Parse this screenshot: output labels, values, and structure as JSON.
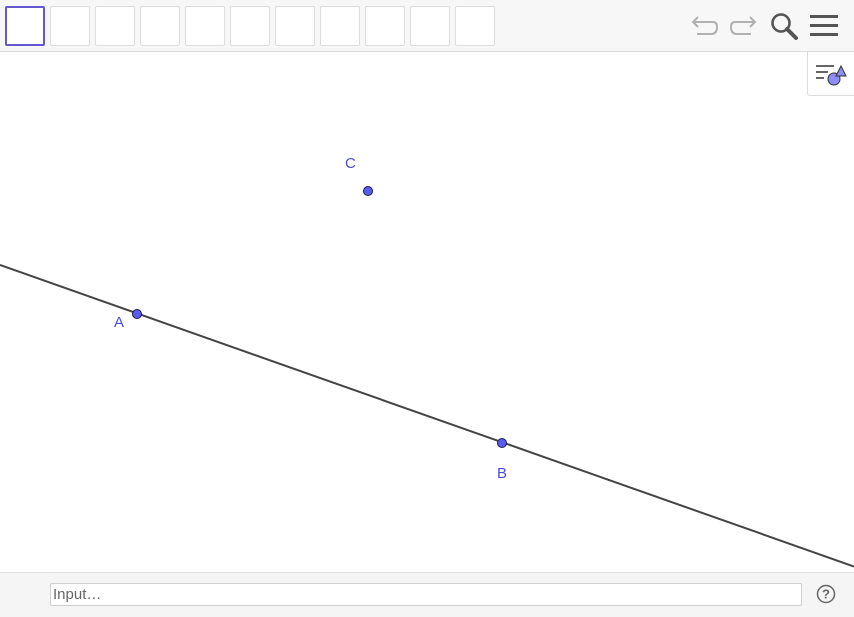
{
  "toolbar": {
    "tool_count": 11,
    "active_tool_index": 0,
    "undo_icon": "undo-icon",
    "redo_icon": "redo-icon",
    "search_icon": "search-icon",
    "menu_icon": "hamburger-menu-icon"
  },
  "stylebar": {
    "icon": "style-bar-toggle-icon"
  },
  "graphics": {
    "points": [
      {
        "name": "A",
        "label": "A"
      },
      {
        "name": "B",
        "label": "B"
      },
      {
        "name": "C",
        "label": "C"
      }
    ],
    "line": {
      "through": [
        "A",
        "B"
      ]
    },
    "colors": {
      "point_fill": "#5b5bef",
      "point_stroke": "#1a1a4d",
      "label": "#4b4bd6",
      "line": "#444444",
      "active_tool_border": "#6557d2"
    }
  },
  "inputbar": {
    "placeholder": "Input…",
    "help_icon": "help-icon",
    "help_symbol": "?"
  }
}
